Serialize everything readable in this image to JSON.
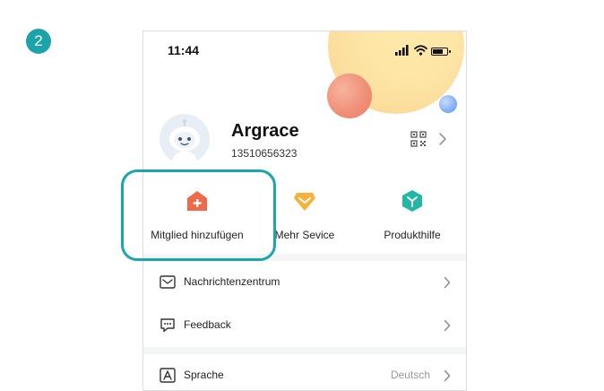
{
  "step_badge": "2",
  "status_bar": {
    "time": "11:44"
  },
  "profile": {
    "name": "Argrace",
    "id": "13510656323"
  },
  "quick_actions": [
    {
      "label": "Mitglied hinzufügen",
      "icon": "home-add-icon",
      "color": "#f06a4a"
    },
    {
      "label": "Mehr Sevice",
      "icon": "diamond-icon",
      "color": "#f6b23a"
    },
    {
      "label": "Produkthilfe",
      "icon": "cube-icon",
      "color": "#22b8a6"
    }
  ],
  "menu": [
    {
      "label": "Nachrichtenzentrum",
      "icon": "mail-icon",
      "value": ""
    },
    {
      "label": "Feedback",
      "icon": "feedback-icon",
      "value": ""
    },
    {
      "label": "Sprache",
      "icon": "language-icon",
      "value": "Deutsch"
    }
  ],
  "colors": {
    "highlight": "#18a7ad",
    "badge": "#1aa3a8"
  }
}
